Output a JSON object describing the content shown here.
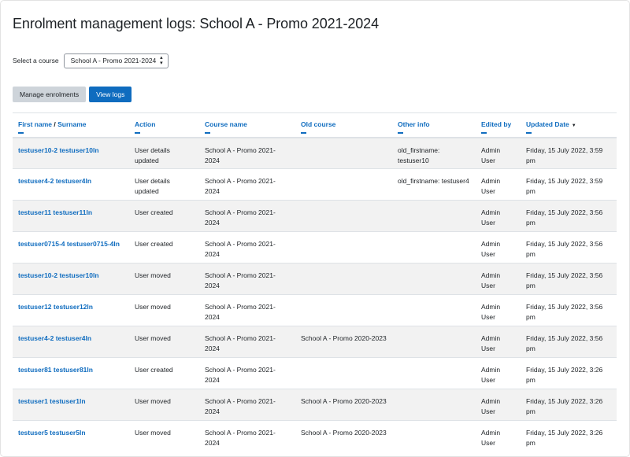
{
  "page": {
    "title": "Enrolment management logs: School A - Promo 2021-2024"
  },
  "course_select": {
    "label": "Select a course",
    "value": "School A - Promo 2021-2024"
  },
  "buttons": {
    "manage": "Manage enrolments",
    "view_logs": "View logs"
  },
  "table": {
    "headers": {
      "first_name": "First name",
      "slash": "/",
      "surname": "Surname",
      "action": "Action",
      "course_name": "Course name",
      "old_course": "Old course",
      "other_info": "Other info",
      "edited_by": "Edited by",
      "updated_date": "Updated Date"
    },
    "rows": [
      {
        "user": "testuser10-2 testuser10ln",
        "action": "User details updated",
        "course": "School A - Promo 2021-2024",
        "old_course": "",
        "other": "old_firstname: testuser10",
        "edited_by": "Admin User",
        "date": "Friday, 15 July 2022, 3:59 pm"
      },
      {
        "user": "testuser4-2 testuser4ln",
        "action": "User details updated",
        "course": "School A - Promo 2021-2024",
        "old_course": "",
        "other": "old_firstname: testuser4",
        "edited_by": "Admin User",
        "date": "Friday, 15 July 2022, 3:59 pm"
      },
      {
        "user": "testuser11 testuser11ln",
        "action": "User created",
        "course": "School A - Promo 2021-2024",
        "old_course": "",
        "other": "",
        "edited_by": "Admin User",
        "date": "Friday, 15 July 2022, 3:56 pm"
      },
      {
        "user": "testuser0715-4 testuser0715-4ln",
        "action": "User created",
        "course": "School A - Promo 2021-2024",
        "old_course": "",
        "other": "",
        "edited_by": "Admin User",
        "date": "Friday, 15 July 2022, 3:56 pm"
      },
      {
        "user": "testuser10-2 testuser10ln",
        "action": "User moved",
        "course": "School A - Promo 2021-2024",
        "old_course": "",
        "other": "",
        "edited_by": "Admin User",
        "date": "Friday, 15 July 2022, 3:56 pm"
      },
      {
        "user": "testuser12 testuser12ln",
        "action": "User moved",
        "course": "School A - Promo 2021-2024",
        "old_course": "",
        "other": "",
        "edited_by": "Admin User",
        "date": "Friday, 15 July 2022, 3:56 pm"
      },
      {
        "user": "testuser4-2 testuser4ln",
        "action": "User moved",
        "course": "School A - Promo 2021-2024",
        "old_course": "School A - Promo 2020-2023",
        "other": "",
        "edited_by": "Admin User",
        "date": "Friday, 15 July 2022, 3:56 pm"
      },
      {
        "user": "testuser81 testuser81ln",
        "action": "User created",
        "course": "School A - Promo 2021-2024",
        "old_course": "",
        "other": "",
        "edited_by": "Admin User",
        "date": "Friday, 15 July 2022, 3:26 pm"
      },
      {
        "user": "testuser1 testuser1ln",
        "action": "User moved",
        "course": "School A - Promo 2021-2024",
        "old_course": "School A - Promo 2020-2023",
        "other": "",
        "edited_by": "Admin User",
        "date": "Friday, 15 July 2022, 3:26 pm"
      },
      {
        "user": "testuser5 testuser5ln",
        "action": "User moved",
        "course": "School A - Promo 2021-2024",
        "old_course": "School A - Promo 2020-2023",
        "other": "",
        "edited_by": "Admin User",
        "date": "Friday, 15 July 2022, 3:26 pm"
      }
    ]
  }
}
